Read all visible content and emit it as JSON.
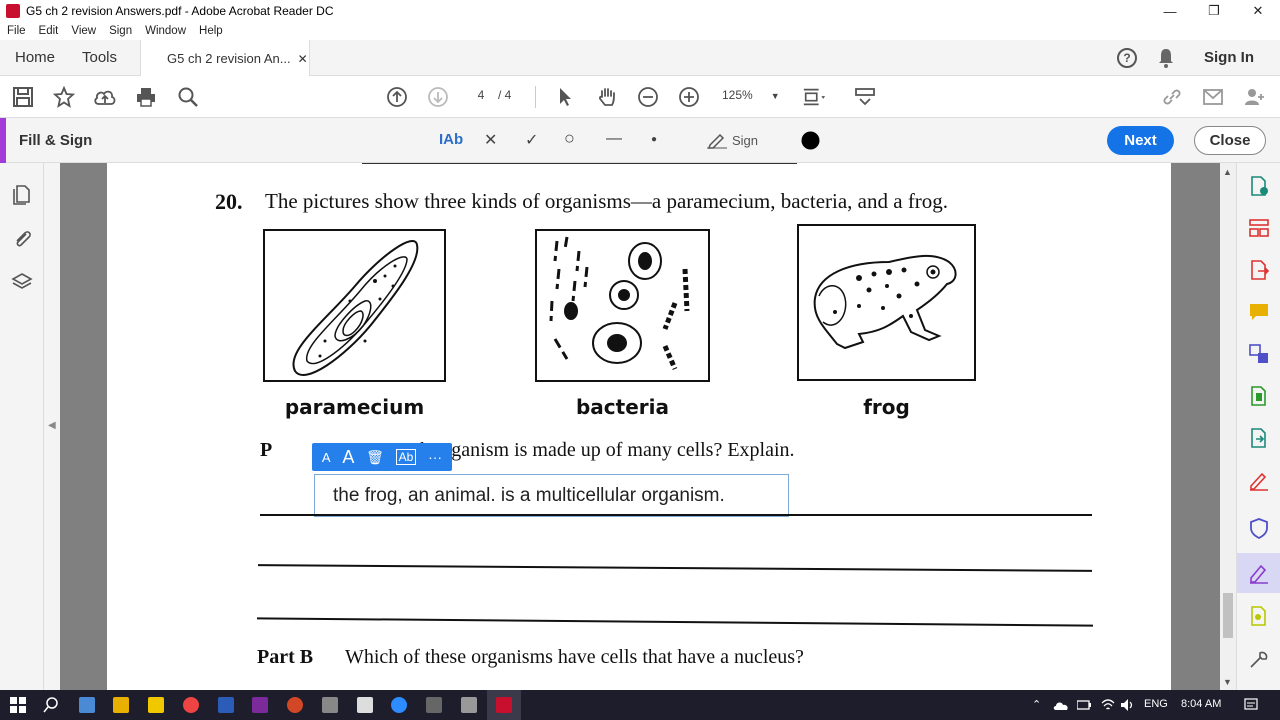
{
  "window": {
    "title": "G5 ch 2 revision Answers.pdf - Adobe Acrobat Reader DC",
    "minimize": "—",
    "restore": "❐",
    "close": "✕"
  },
  "menu": [
    "File",
    "Edit",
    "View",
    "Sign",
    "Window",
    "Help"
  ],
  "tabs": {
    "home": "Home",
    "tools": "Tools",
    "doc": "G5 ch 2 revision An...",
    "doc_close": "✕",
    "help": "?",
    "signin": "Sign In"
  },
  "toolbar": {
    "page_current": "4",
    "page_total": "/  4",
    "zoom": "125%"
  },
  "fillsign": {
    "label": "Fill & Sign",
    "text_tool": "IAb",
    "cross_tool": "✕",
    "check_tool": "✓",
    "circle_tool": "○",
    "line_tool": "—",
    "dot_tool": "●",
    "sign_label": "Sign",
    "next_label": "Next",
    "close_label": "Close",
    "accent_color": "#a33bd6",
    "next_color": "#1473e6"
  },
  "document": {
    "question_number": "20.",
    "question_text": "The pictures show three kinds of organisms—a paramecium, bacteria, and a frog.",
    "organisms": [
      "paramecium",
      "bacteria",
      "frog"
    ],
    "part_a_label": "P",
    "part_a_text": "h organism is made up of many cells? Explain.",
    "answer": "the frog, an animal. is a multicellular organism.",
    "part_b_label": "Part B",
    "part_b_text": "Which of these organisms have cells that have a nucleus?"
  },
  "fieldtoolbar": {
    "small_a": "A",
    "big_a": "A",
    "trash": "🗑",
    "ab": "Ab",
    "more": "···"
  },
  "taskbar": {
    "language": "ENG",
    "time": "8:04 AM"
  }
}
